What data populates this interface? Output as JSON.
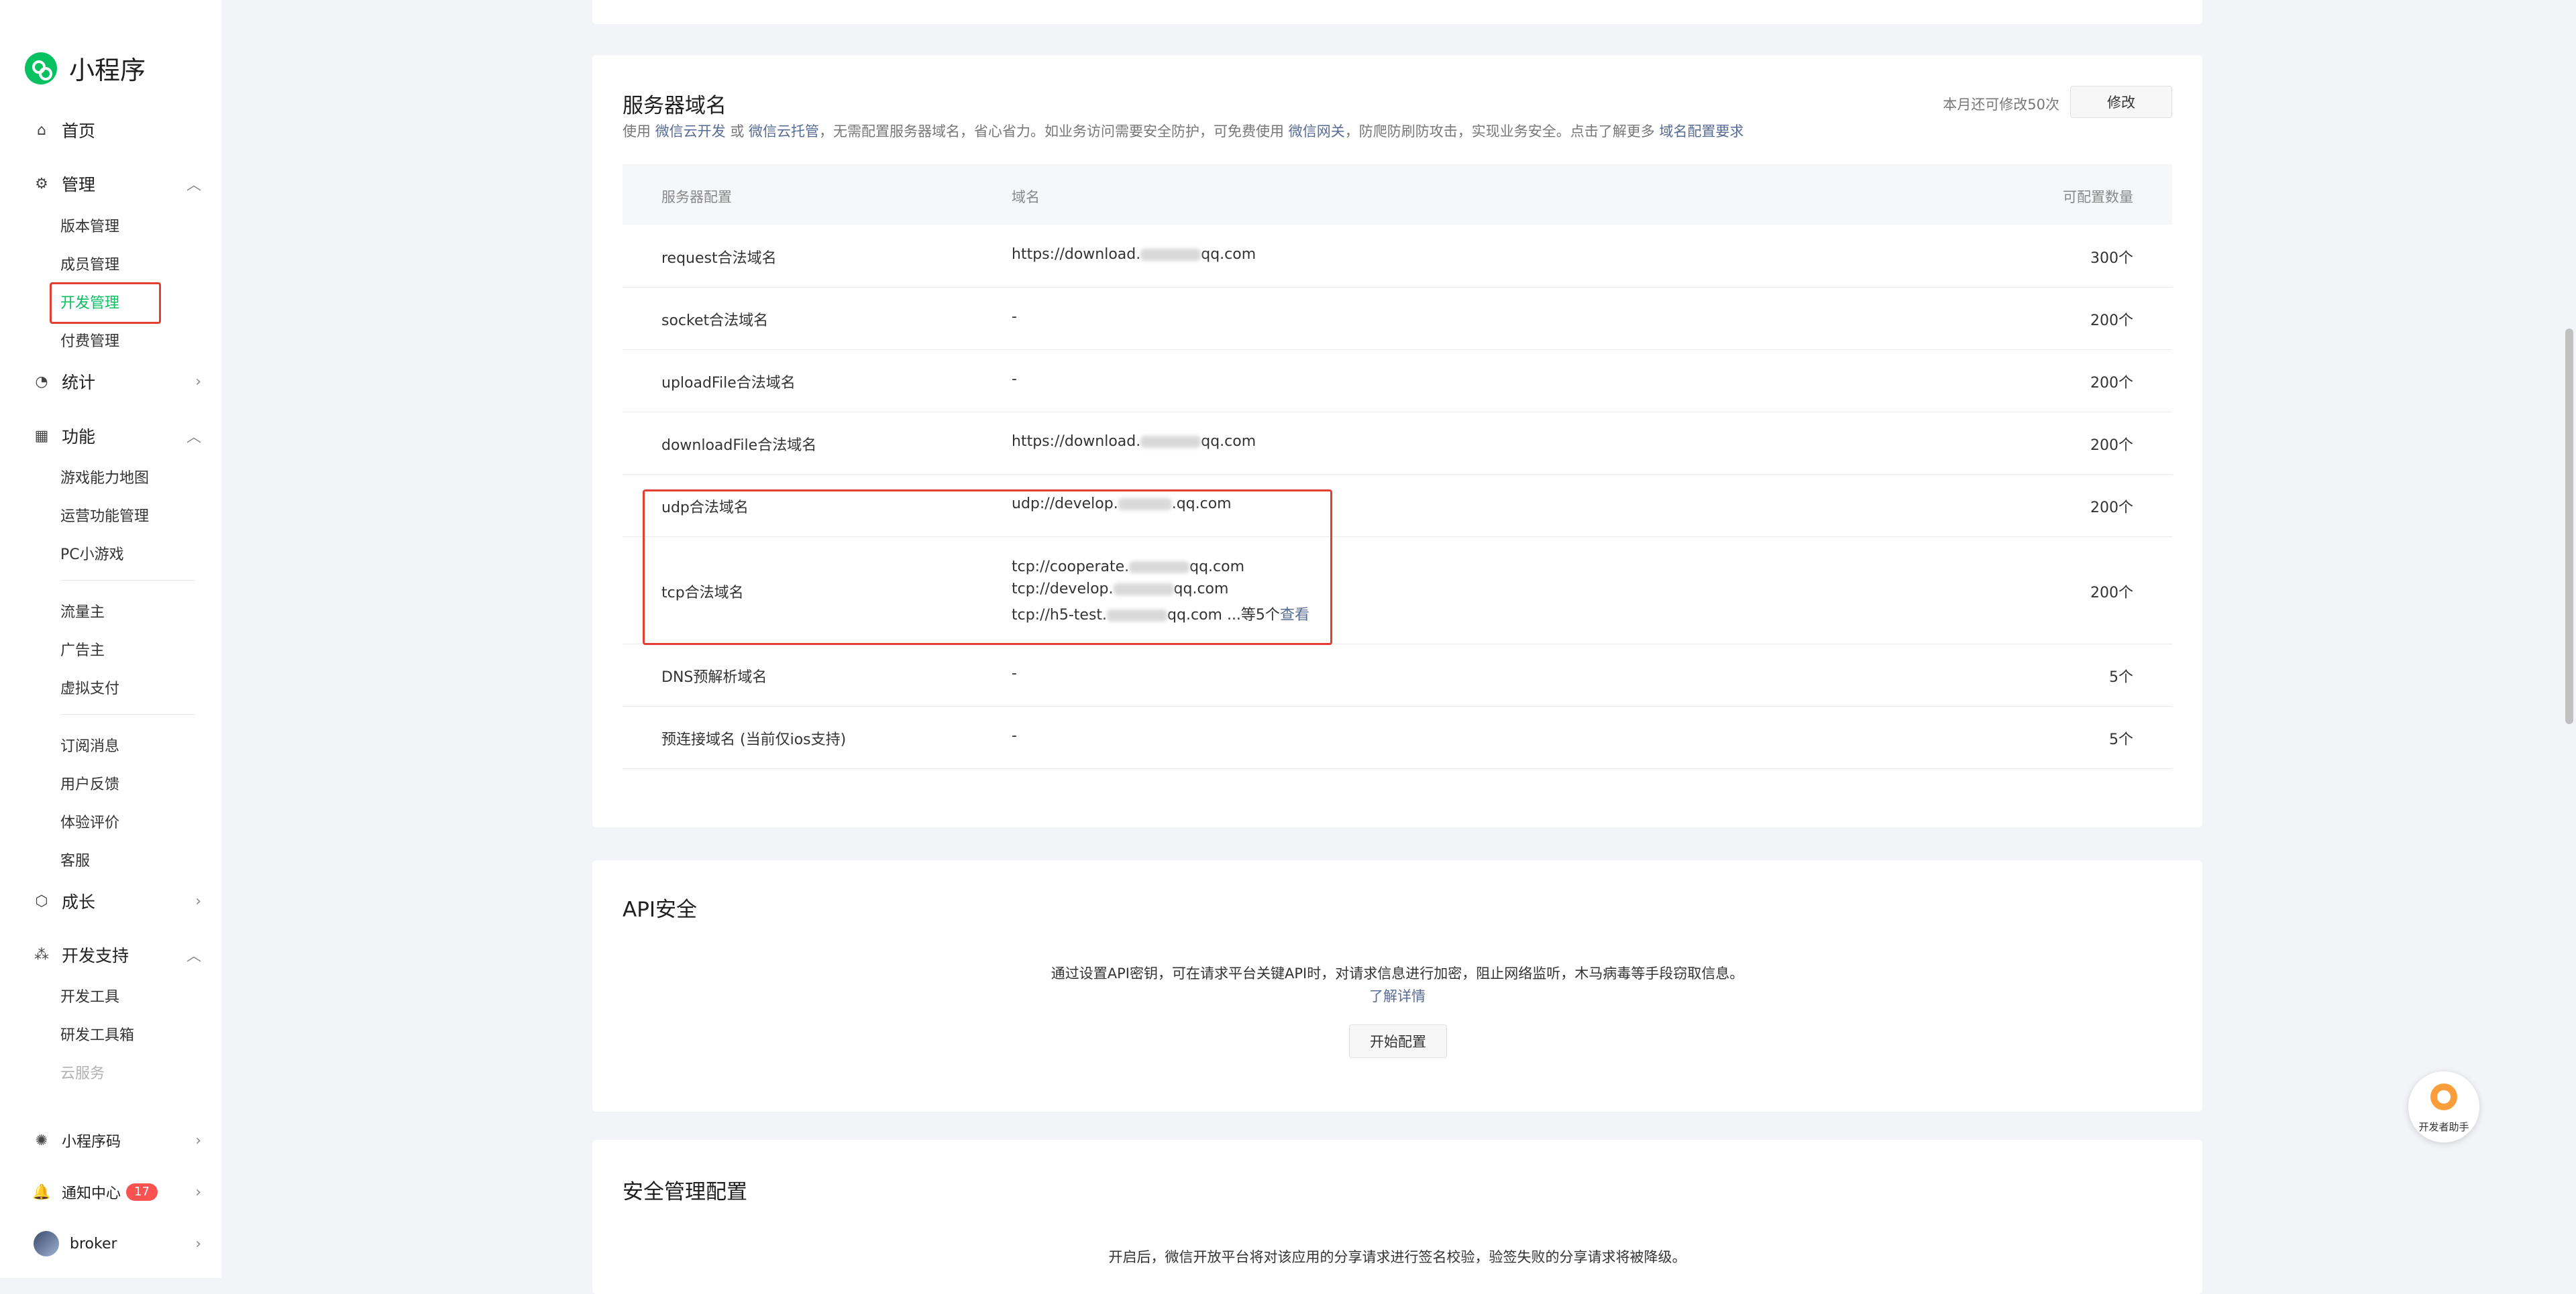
{
  "app": {
    "title": "小程序"
  },
  "sidebar": {
    "home": "首页",
    "manage": {
      "label": "管理",
      "items": [
        "版本管理",
        "成员管理",
        "开发管理",
        "付费管理"
      ]
    },
    "stats": "统计",
    "features": {
      "label": "功能",
      "items": [
        "游戏能力地图",
        "运营功能管理",
        "PC小游戏",
        "流量主",
        "广告主",
        "虚拟支付",
        "订阅消息",
        "用户反馈",
        "体验评价",
        "客服"
      ]
    },
    "growth": "成长",
    "devsupport": {
      "label": "开发支持",
      "items": [
        "开发工具",
        "研发工具箱",
        "云服务"
      ]
    },
    "qrcode": "小程序码",
    "notice": {
      "label": "通知中心",
      "badge": "17"
    },
    "user": "broker"
  },
  "server": {
    "title": "服务器域名",
    "desc": {
      "p1": "使用 ",
      "link1": "微信云开发",
      "p2": " 或 ",
      "link2": "微信云托管",
      "p3": "，无需配置服务器域名，省心省力。如业务访问需要安全防护，可免费使用 ",
      "link3": "微信网关",
      "p4": "，防爬防刷防攻击，实现业务安全。点击了解更多 ",
      "link4": "域名配置要求"
    },
    "quota": "本月还可修改50次",
    "modify_btn": "修改",
    "headers": [
      "服务器配置",
      "域名",
      "可配置数量"
    ],
    "rows": [
      {
        "name": "request合法域名",
        "d1": "https://download.",
        "d2": "qq.com",
        "count": "300个"
      },
      {
        "name": "socket合法域名",
        "d1": "-",
        "count": "200个"
      },
      {
        "name": "uploadFile合法域名",
        "d1": "-",
        "count": "200个"
      },
      {
        "name": "downloadFile合法域名",
        "d1": "https://download.",
        "d2": "qq.com",
        "count": "200个"
      },
      {
        "name": "udp合法域名",
        "d1": "udp://develop.",
        "d2": ".qq.com",
        "count": "200个"
      },
      {
        "name": "tcp合法域名",
        "count": "200个",
        "lines": [
          {
            "a": "tcp://cooperate.",
            "b": "qq.com"
          },
          {
            "a": "tcp://develop.",
            "b": "qq.com"
          },
          {
            "a": "tcp://h5-test.",
            "b": "qq.com ...等5个"
          }
        ],
        "view": "查看"
      },
      {
        "name": "DNS预解析域名",
        "d1": "-",
        "count": "5个"
      },
      {
        "name": "预连接域名 (当前仅ios支持)",
        "d1": "-",
        "count": "5个"
      }
    ]
  },
  "api": {
    "title": "API安全",
    "desc": "通过设置API密钥，可在请求平台关键API时，对请求信息进行加密，阻止网络监听，木马病毒等手段窃取信息。",
    "more": "了解详情",
    "btn": "开始配置"
  },
  "security": {
    "title": "安全管理配置",
    "desc": "开启后，微信开放平台将对该应用的分享请求进行签名校验，验签失败的分享请求将被降级。"
  },
  "helper": {
    "label": "开发者助手"
  }
}
